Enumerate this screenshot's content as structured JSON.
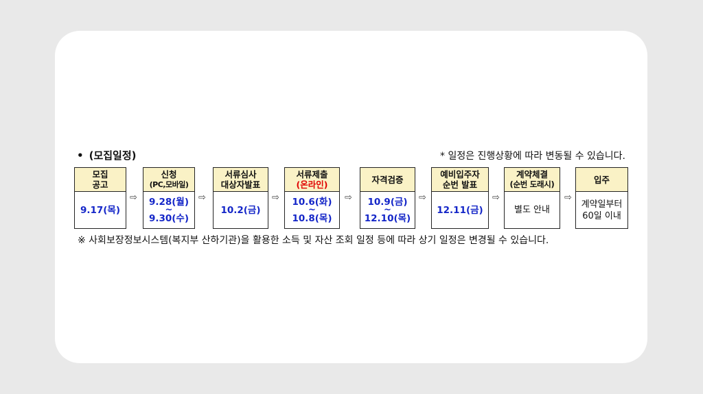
{
  "heading": {
    "bullet": "•",
    "text": "(모집일정)"
  },
  "note_top": "*  일정은 진행상황에 따라 변동될 수 있습니다.",
  "steps": [
    {
      "head1": "모집",
      "head2": "공고",
      "body1": "9.17(목)"
    },
    {
      "head1": "신청",
      "head2": "(PC,모바일)",
      "body1": "9.28(월)",
      "tilde": "~",
      "body2": "9.30(수)"
    },
    {
      "head1": "서류심사",
      "head2": "대상자발표",
      "body1": "10.2(금)"
    },
    {
      "head1": "서류제출",
      "head2": "(온라인)",
      "body1": "10.6(화)",
      "tilde": "~",
      "body2": "10.8(목)"
    },
    {
      "head1": "자격검증",
      "body1": "10.9(금)",
      "tilde": "~",
      "body2": "12.10(목)"
    },
    {
      "head1": "예비입주자",
      "head2": "순번 발표",
      "body1": "12.11(금)"
    },
    {
      "head1": "계약체결",
      "head2": "(순번 도래시)",
      "body1": "별도 안내"
    },
    {
      "head1": "입주",
      "body1": "계약일부터",
      "body2": "60일 이내"
    }
  ],
  "arrow": "⇨",
  "note_bottom": "※ 사회보장정보시스템(복지부 산하기관)을 활용한 소득 및 자산 조회 일정 등에 따라 상기 일정은 변경될 수 있습니다.",
  "colors": {
    "header_bg": "#faf2c6",
    "date_blue": "#1426c8",
    "online_red": "#e00000"
  }
}
